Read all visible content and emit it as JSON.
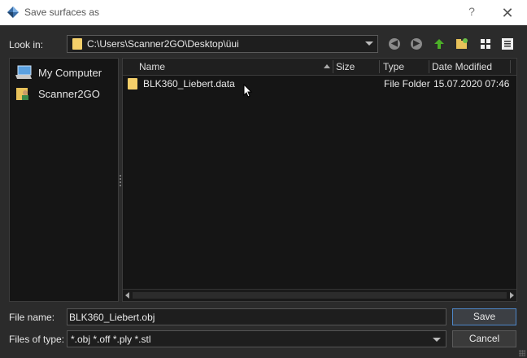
{
  "window": {
    "title": "Save surfaces as",
    "help_glyph": "?",
    "close_glyph": "✕"
  },
  "lookin": {
    "label": "Look in:",
    "path": "C:\\Users\\Scanner2GO\\Desktop\\üui"
  },
  "toolbar": {
    "back_icon": "back-arrow-icon",
    "forward_icon": "forward-arrow-icon",
    "up_icon": "up-arrow-icon",
    "new_folder_icon": "new-folder-icon",
    "list_view_icon": "list-view-icon",
    "detail_view_icon": "detail-view-icon"
  },
  "sidebar": {
    "items": [
      {
        "label": "My Computer",
        "icon": "computer-icon"
      },
      {
        "label": "Scanner2GO",
        "icon": "user-folder-icon"
      }
    ]
  },
  "filelist": {
    "columns": [
      "Name",
      "Size",
      "Type",
      "Date Modified"
    ],
    "rows": [
      {
        "name": "BLK360_Liebert.data",
        "size": "",
        "type": "File Folder",
        "date": "15.07.2020 07:46"
      }
    ]
  },
  "filename": {
    "label": "File name:",
    "value": "BLK360_Liebert.obj"
  },
  "filetype": {
    "label": "Files of type:",
    "value": "*.obj *.off *.ply *.stl"
  },
  "buttons": {
    "save": "Save",
    "cancel": "Cancel"
  },
  "colors": {
    "accent": "#4e86c8",
    "folder": "#f4cf6a",
    "background": "#2b2b2b"
  }
}
